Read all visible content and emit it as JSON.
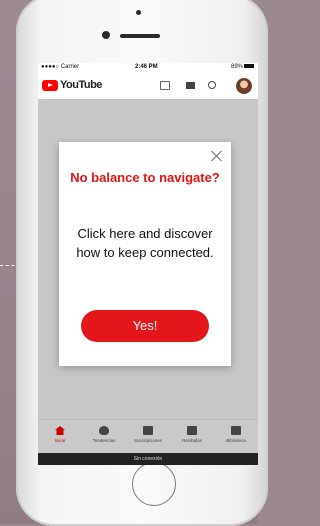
{
  "status": {
    "carrier": "●●●●○ Carrier",
    "time": "2:46 PM",
    "battery": "89%"
  },
  "appbar": {
    "brand": "YouTube"
  },
  "modal": {
    "title": "No balance to navigate?",
    "body": "Click here and discover how to keep connected.",
    "button": "Yes!"
  },
  "tabs": [
    {
      "label": "Inicio",
      "icon": "home-icon"
    },
    {
      "label": "Tendencias",
      "icon": "trending-icon"
    },
    {
      "label": "Suscripciones",
      "icon": "subscriptions-icon"
    },
    {
      "label": "Recibidos",
      "icon": "inbox-icon"
    },
    {
      "label": "Biblioteca",
      "icon": "library-icon"
    }
  ],
  "offline_banner": "Sin conexión",
  "colors": {
    "accent": "#e3171b",
    "brand": "#ff0000"
  }
}
